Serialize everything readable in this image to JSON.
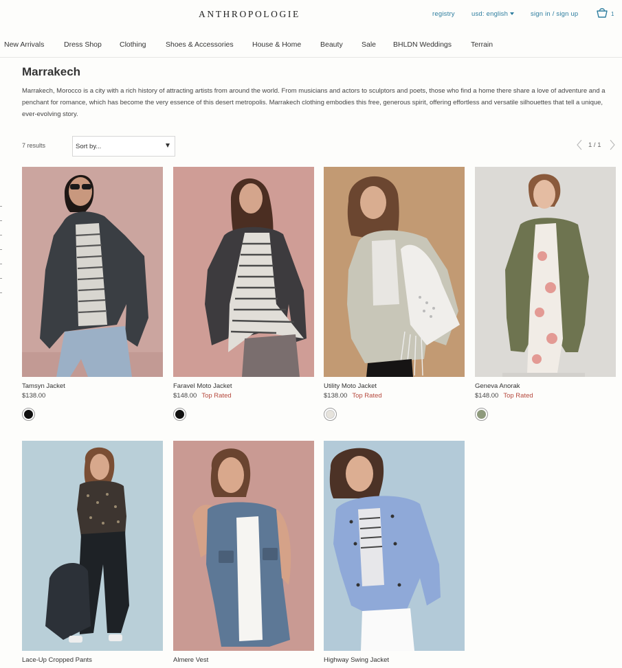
{
  "header": {
    "logo": "ANTHROPOLOGIE",
    "registry": "registry",
    "language": "usd: english",
    "sign_in": "sign in / sign up",
    "cart_count": "1"
  },
  "nav": {
    "items": [
      "New Arrivals",
      "Dress Shop",
      "Clothing",
      "Shoes & Accessories",
      "House & Home",
      "Beauty",
      "Sale",
      "BHLDN Weddings",
      "Terrain"
    ]
  },
  "page": {
    "title": "Marrakech",
    "description": "Marrakech, Morocco is a city with a rich history of attracting artists from around the world. From musicians and actors to sculptors and poets, those who find a home there share a love of adventure and a penchant for romance, which has become the very essence of this desert metropolis. Marrakech clothing embodies this free, generous spirit, offering effortless and versatile silhouettes that tell a unique, ever-evolving story."
  },
  "toolbar": {
    "results": "7 results",
    "sort_label": "Sort by...",
    "pagination": "1 / 1"
  },
  "products": [
    {
      "name": "Tamsyn Jacket",
      "price": "$138.00",
      "badge": "",
      "swatch": "#111111"
    },
    {
      "name": "Faravel Moto Jacket",
      "price": "$148.00",
      "badge": "Top Rated",
      "swatch": "#111111"
    },
    {
      "name": "Utility Moto Jacket",
      "price": "$138.00",
      "badge": "Top Rated",
      "swatch": "#e6e3dc"
    },
    {
      "name": "Geneva Anorak",
      "price": "$148.00",
      "badge": "Top Rated",
      "swatch": "#8e9a7c"
    },
    {
      "name": "Lace-Up Cropped Pants",
      "price": "",
      "badge": "",
      "swatch": ""
    },
    {
      "name": "Almere Vest",
      "price": "",
      "badge": "",
      "swatch": ""
    },
    {
      "name": "Highway Swing Jacket",
      "price": "",
      "badge": "",
      "swatch": ""
    }
  ],
  "colors": {
    "accent_link": "#2b7c9e",
    "badge": "#b5483c"
  }
}
